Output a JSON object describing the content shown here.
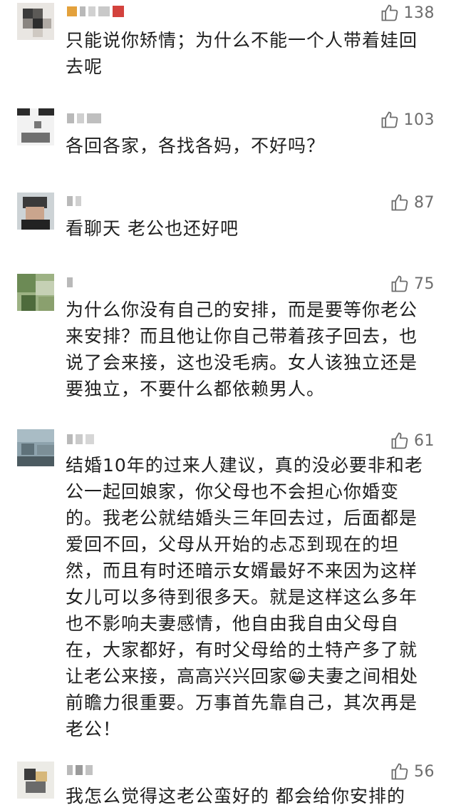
{
  "comments": [
    {
      "likes": "138",
      "text": "只能说你矫情；为什么不能一个人带着娃回\n去呢"
    },
    {
      "likes": "103",
      "text": "各回各家，各找各妈，不好吗？"
    },
    {
      "likes": "87",
      "text": "看聊天 老公也还好吧"
    },
    {
      "likes": "75",
      "text": "为什么你没有自己的安排，而是要等你老公\n来安排？而且他让你自己带着孩子回去，也\n说了会来接，这也没毛病。女人该独立还是\n要独立，不要什么都依赖男人。"
    },
    {
      "likes": "61",
      "text": "结婚10年的过来人建议，真的没必要非和老\n公一起回娘家，你父母也不会担心你婚变\n的。我老公就结婚头三年回去过，后面都是\n爱回不回，父母从开始的忐忑到现在的坦\n然，而且有时还暗示女婿最好不来因为这样\n女儿可以多待到很多天。就是这样这么多年\n也不影响夫妻感情，他自由我自由父母自\n在，大家都好，有时父母给的土特产多了就\n让老公来接，高高兴兴回家😁夫妻之间相处\n前瞻力很重要。万事首先靠自己，其次再是\n老公！"
    },
    {
      "likes": "56",
      "text": "我怎么觉得这老公蛮好的 都会给你安排的"
    }
  ],
  "icons": {
    "like": "thumbs-up-outline-icon",
    "avatar": "pixelated-avatar"
  },
  "colors": {
    "text": "#1e1e1e",
    "meta": "#6d6d6d",
    "background": "#ffffff"
  }
}
